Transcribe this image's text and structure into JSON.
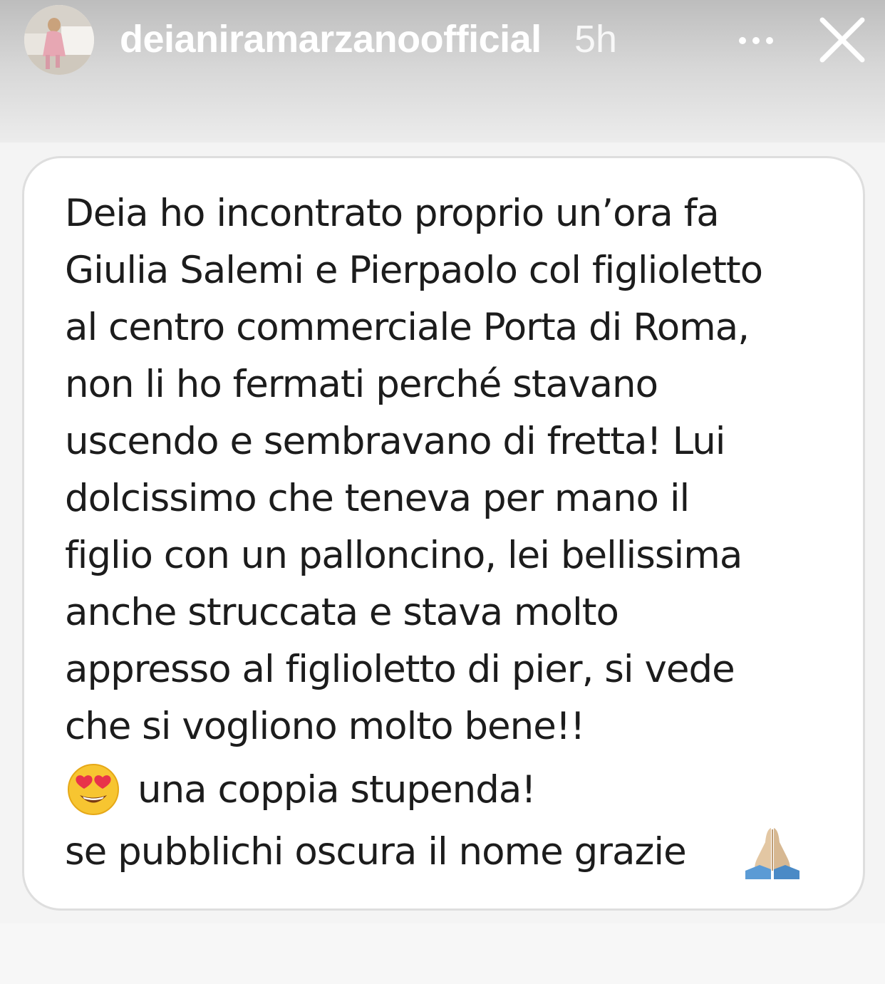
{
  "header": {
    "username": "deianiramarzanoofficial",
    "timestamp": "5h",
    "more_icon": "more-horizontal-icon",
    "close_icon": "close-icon"
  },
  "message": {
    "lines": [
      "Deia ho incontrato proprio un’ora fa",
      "Giulia Salemi e Pierpaolo col figlioletto",
      "al centro commerciale Porta di Roma,",
      "non li ho fermati perché stavano",
      "uscendo e sembravano di fretta! Lui",
      "dolcissimo che teneva per mano il",
      "figlio con un palloncino, lei bellissima",
      "anche struccata e stava molto",
      "appresso al figlioletto di pier, si vede",
      "che si vogliono molto bene!!"
    ],
    "line_12": "una coppia stupenda!",
    "line_13": "se pubblichi oscura il nome grazie",
    "emoji_heart_eyes": "heart-eyes-emoji",
    "emoji_pray": "folded-hands-emoji"
  },
  "colors": {
    "header_top": "#bdbdbd",
    "header_bottom": "#ececec",
    "card_background": "#ffffff",
    "card_border": "#dedede",
    "text": "#1c1c1c"
  }
}
